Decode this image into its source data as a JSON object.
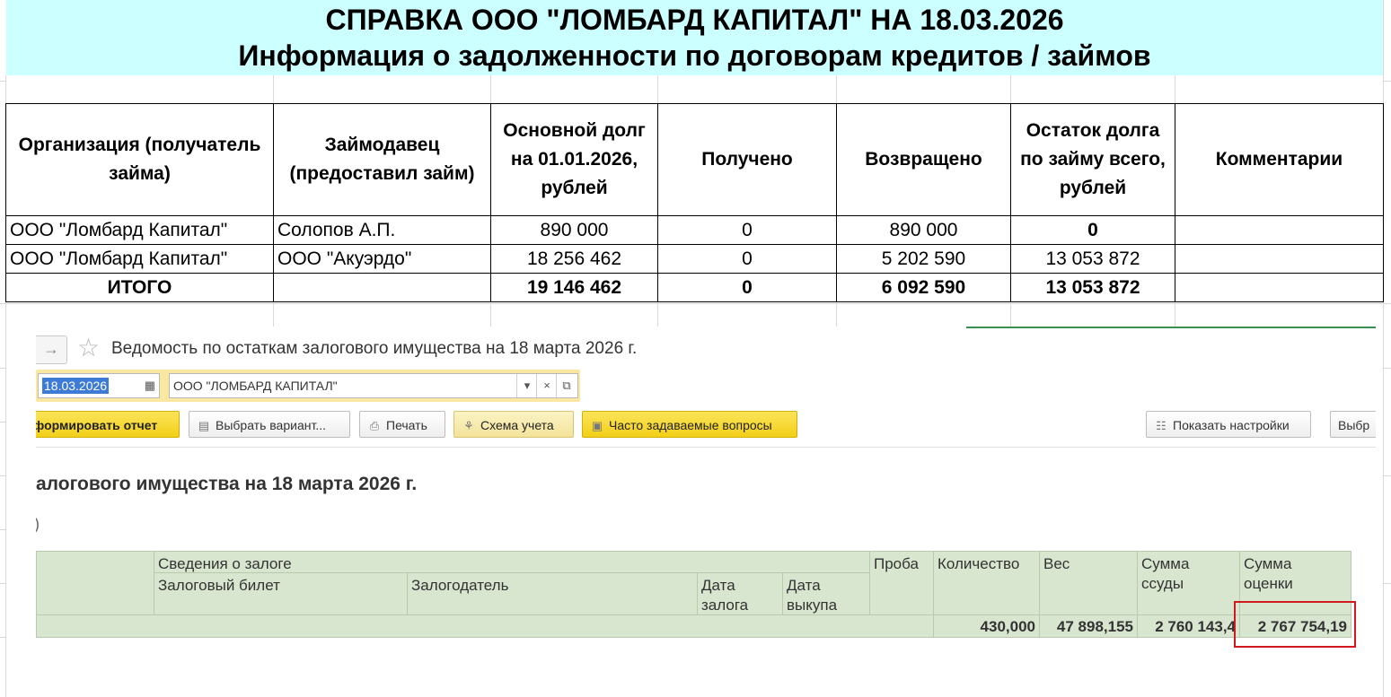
{
  "header": {
    "line1": "СПРАВКА ООО \"ЛОМБАРД КАПИТАЛ\" НА 18.03.2026",
    "line2": "Информация о задолженности по договорам кредитов / займов"
  },
  "debt_table": {
    "headers": [
      "Организация (получатель займа)",
      "Займодавец (предоставил займ)",
      "Основной долг на 01.01.2026, рублей",
      "Получено",
      "Возвращено",
      "Остаток долга по займу всего, рублей",
      "Комментарии"
    ],
    "rows": [
      {
        "org": "ООО \"Ломбард Капитал\"",
        "lender": "Солопов А.П.",
        "principal": "890 000",
        "received": "0",
        "returned": "890 000",
        "balance": "0",
        "comment": ""
      },
      {
        "org": "ООО \"Ломбард Капитал\"",
        "lender": "ООО \"Акуэрдо\"",
        "principal": "18 256 462",
        "received": "0",
        "returned": "5 202 590",
        "balance": "13 053 872",
        "comment": ""
      }
    ],
    "total": {
      "label": "ИТОГО",
      "lender": "",
      "principal": "19 146 462",
      "received": "0",
      "returned": "6 092 590",
      "balance": "13 053 872",
      "comment": ""
    }
  },
  "report_window": {
    "nav_forward": "→",
    "favorite_icon": "star-icon",
    "title": "Ведомость по остаткам залогового имущества на 18 марта 2026 г.",
    "date_value": "18.03.2026",
    "org_value": "ООО \"ЛОМБАРД КАПИТАЛ\"",
    "org_dropdown": "▾",
    "org_clear": "×",
    "org_open": "⧉",
    "toolbar": {
      "generate": "формировать отчет",
      "choose_variant": "Выбрать вариант...",
      "print": "Печать",
      "accounting_scheme": "Схема учета",
      "faq": "Часто задаваемые вопросы",
      "show_settings": "Показать настройки",
      "select_cut": "Выбр"
    },
    "report_heading": "алогового имущества на 18 марта 2026 г.",
    "report_fragment": ")",
    "grid": {
      "group_header": "Сведения о залоге",
      "columns": {
        "ticket": "Залоговый билет",
        "pledgor": "Залогодатель",
        "pledge_date": "Дата залога",
        "redeem_date": "Дата выкупа",
        "assay": "Проба",
        "quantity": "Количество",
        "weight": "Вес",
        "loan_sum": "Сумма ссуды",
        "valuation_sum": "Сумма оценки"
      },
      "totals": {
        "quantity": "430,000",
        "weight": "47 898,155",
        "loan_sum": "2 760 143,4",
        "valuation_sum": "2 767 754,19"
      }
    },
    "highlight_color": "#d0181e"
  }
}
